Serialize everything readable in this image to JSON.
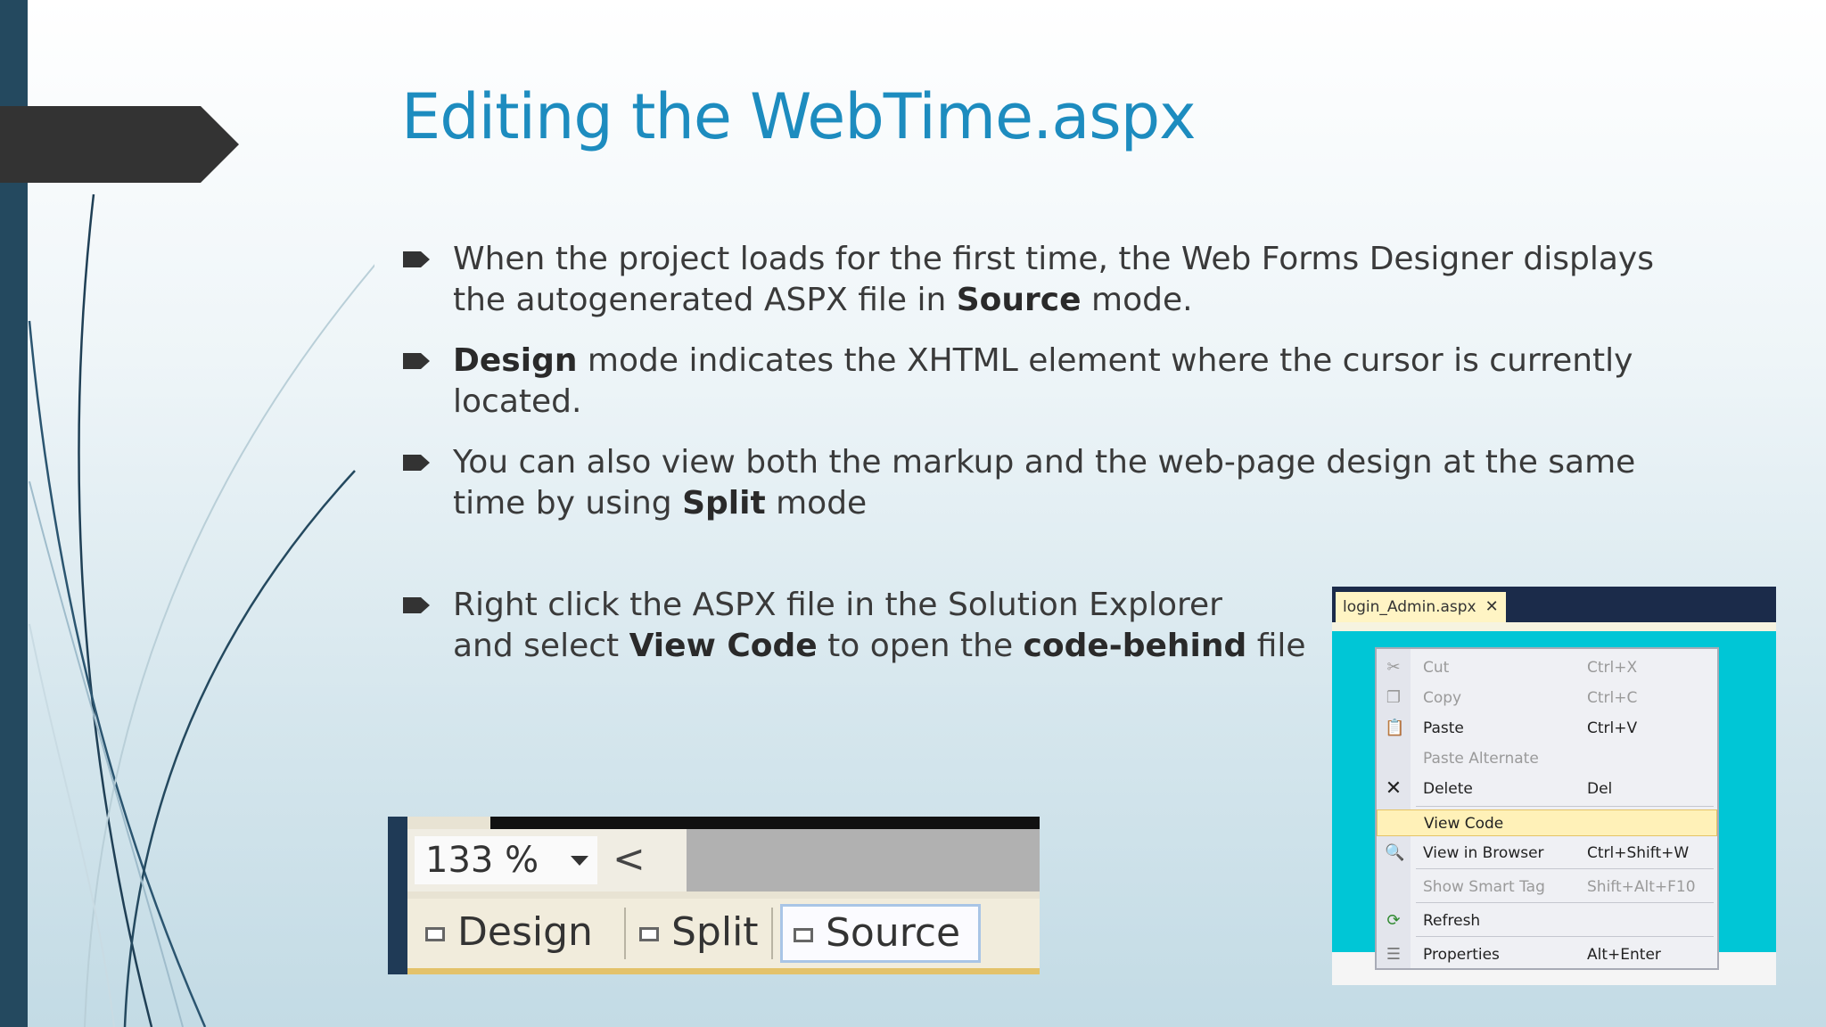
{
  "slide": {
    "title": "Editing the WebTime.aspx",
    "bullets": [
      {
        "parts": [
          "When the project loads for the first time, the Web Forms Designer displays the autogenerated ASPX file in ",
          "Source",
          " mode."
        ]
      },
      {
        "parts": [
          "",
          "Design",
          " mode indicates the XHTML element where the cursor is currently located."
        ]
      },
      {
        "parts": [
          "You can also view both the markup and the web-page design at the same time by using ",
          "Split",
          " mode"
        ]
      },
      {
        "parts": [
          "Right click the ASPX file in the Solution Explorer",
          "and select ",
          "View Code",
          " to open the ",
          "code-behind",
          " file"
        ]
      }
    ]
  },
  "toolbar": {
    "zoom": "133 %",
    "back_glyph": "<",
    "tabs": {
      "design": "Design",
      "split": "Split",
      "source": "Source"
    }
  },
  "context_menu": {
    "tab_title": "login_Admin.aspx",
    "close_glyph": "✕",
    "items": [
      {
        "label": "Cut",
        "shortcut": "Ctrl+X",
        "icon": "scissors-icon",
        "disabled": true
      },
      {
        "label": "Copy",
        "shortcut": "Ctrl+C",
        "icon": "copy-icon",
        "disabled": true
      },
      {
        "label": "Paste",
        "shortcut": "Ctrl+V",
        "icon": "paste-icon",
        "disabled": false
      },
      {
        "label": "Paste Alternate",
        "shortcut": "",
        "icon": "",
        "disabled": true
      },
      {
        "label": "Delete",
        "shortcut": "Del",
        "icon": "delete-icon",
        "disabled": false
      },
      {
        "label": "View Code",
        "shortcut": "",
        "icon": "",
        "disabled": false,
        "highlighted": true
      },
      {
        "label": "View in Browser",
        "shortcut": "Ctrl+Shift+W",
        "icon": "browser-icon",
        "disabled": false
      },
      {
        "label": "Show Smart Tag",
        "shortcut": "Shift+Alt+F10",
        "icon": "",
        "disabled": true
      },
      {
        "label": "Refresh",
        "shortcut": "",
        "icon": "refresh-icon",
        "disabled": false
      },
      {
        "label": "Properties",
        "shortcut": "Alt+Enter",
        "icon": "properties-icon",
        "disabled": false
      }
    ]
  },
  "colors": {
    "title": "#1d8cbf",
    "left_bar": "#24495f",
    "arrow_tab": "#333333",
    "menu_highlight": "#fff1b8"
  }
}
